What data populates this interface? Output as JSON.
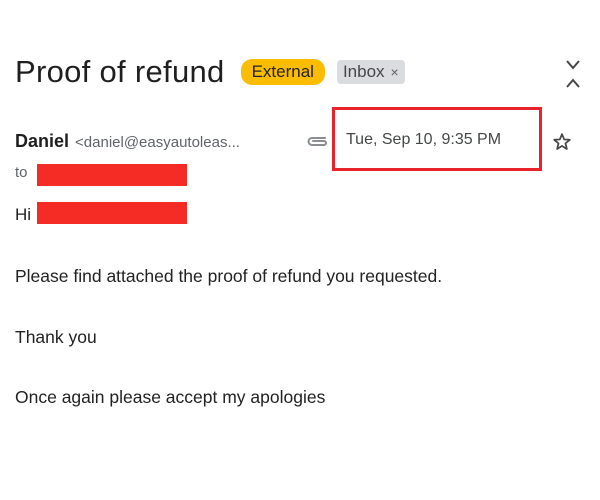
{
  "email": {
    "subject": "Proof of refund",
    "labels": {
      "external": "External",
      "inbox": "Inbox",
      "inbox_remove": "×"
    },
    "sender": {
      "name": "Daniel",
      "email": "<daniel@easyautoleas..."
    },
    "date": "Tue, Sep 10, 9:35 PM",
    "recipient_prefix": "to",
    "greeting": "Hi",
    "body": [
      "Please find attached the proof of refund you requested.",
      "Thank you",
      "Once again please accept my apologies"
    ]
  },
  "icons": {
    "expand": "unfold-less-icon",
    "attachment": "paperclip-icon",
    "star": "star-outline-icon"
  },
  "colors": {
    "external_label": "#fbbc04",
    "inbox_label": "#dadce0",
    "highlight": "#e8232a",
    "redaction": "#f52b26"
  }
}
